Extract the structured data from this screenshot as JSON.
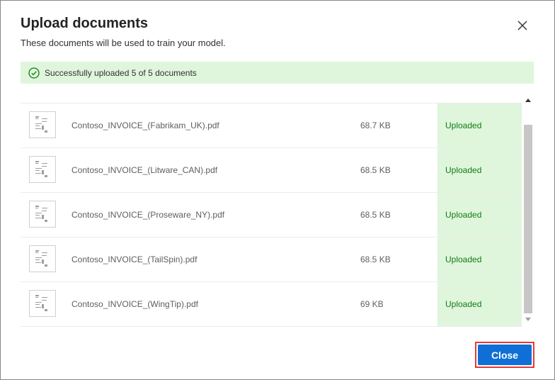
{
  "dialog": {
    "title": "Upload documents",
    "subtitle": "These documents will be used to train your model.",
    "close_icon": "close-icon"
  },
  "banner": {
    "icon": "checkmark-circle-icon",
    "message": "Successfully uploaded 5 of 5 documents"
  },
  "files": [
    {
      "name": "Contoso_INVOICE_(Fabrikam_UK).pdf",
      "size": "68.7 KB",
      "status": "Uploaded"
    },
    {
      "name": "Contoso_INVOICE_(Litware_CAN).pdf",
      "size": "68.5 KB",
      "status": "Uploaded"
    },
    {
      "name": "Contoso_INVOICE_(Proseware_NY).pdf",
      "size": "68.5 KB",
      "status": "Uploaded"
    },
    {
      "name": "Contoso_INVOICE_(TailSpin).pdf",
      "size": "68.5 KB",
      "status": "Uploaded"
    },
    {
      "name": "Contoso_INVOICE_(WingTip).pdf",
      "size": "69 KB",
      "status": "Uploaded"
    }
  ],
  "footer": {
    "close_label": "Close"
  },
  "colors": {
    "success_bg": "#dff6dd",
    "success_text": "#107c10",
    "primary_button": "#0f6fd6",
    "highlight_border": "#e53935"
  }
}
